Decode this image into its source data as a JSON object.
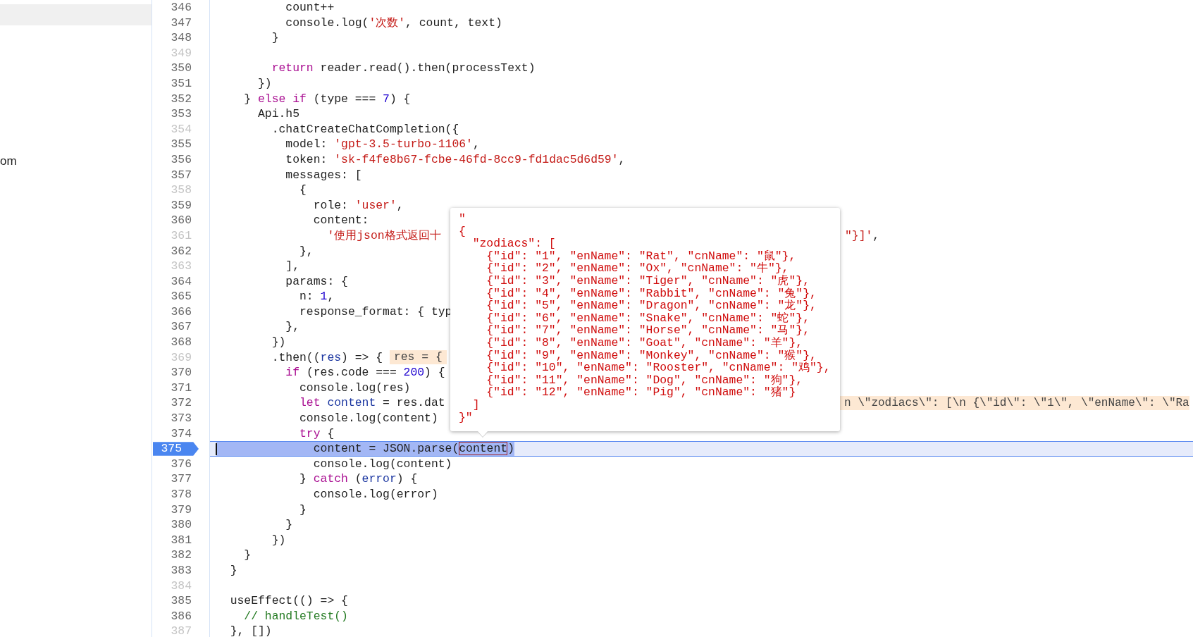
{
  "sidebar": {
    "items": [
      {
        "label": "om"
      }
    ]
  },
  "editor": {
    "lines": [
      {
        "number": "346",
        "breakable": true,
        "paused": false,
        "tokens": [
          {
            "kind": "plain",
            "text": "          count++"
          }
        ]
      },
      {
        "number": "347",
        "breakable": true,
        "paused": false,
        "tokens": [
          {
            "kind": "plain",
            "text": "          console.log("
          },
          {
            "kind": "string",
            "text": "'次数'"
          },
          {
            "kind": "plain",
            "text": ", count, text)"
          }
        ]
      },
      {
        "number": "348",
        "breakable": true,
        "paused": false,
        "tokens": [
          {
            "kind": "plain",
            "text": "        }"
          }
        ]
      },
      {
        "number": "349",
        "breakable": false,
        "paused": false
      },
      {
        "number": "350",
        "breakable": true,
        "paused": false,
        "tokens": [
          {
            "kind": "keyword",
            "text": "        return"
          },
          {
            "kind": "plain",
            "text": " reader.read().then(processText)"
          }
        ]
      },
      {
        "number": "351",
        "breakable": true,
        "paused": false,
        "tokens": [
          {
            "kind": "plain",
            "text": "      })"
          }
        ]
      },
      {
        "number": "352",
        "breakable": true,
        "paused": false,
        "tokens": [
          {
            "kind": "plain",
            "text": "    } "
          },
          {
            "kind": "keyword",
            "text": "else if"
          },
          {
            "kind": "plain",
            "text": " (type === "
          },
          {
            "kind": "number",
            "text": "7"
          },
          {
            "kind": "plain",
            "text": ") {"
          }
        ]
      },
      {
        "number": "353",
        "breakable": true,
        "paused": false,
        "tokens": [
          {
            "kind": "plain",
            "text": "      Api.h5"
          }
        ]
      },
      {
        "number": "354",
        "breakable": false,
        "paused": false,
        "tokens": [
          {
            "kind": "plain",
            "text": "        .chatCreateChatCompletion({"
          }
        ]
      },
      {
        "number": "355",
        "breakable": true,
        "paused": false,
        "tokens": [
          {
            "kind": "plain",
            "text": "          model: "
          },
          {
            "kind": "string",
            "text": "'gpt-3.5-turbo-1106'"
          },
          {
            "kind": "plain",
            "text": ","
          }
        ]
      },
      {
        "number": "356",
        "breakable": true,
        "paused": false,
        "tokens": [
          {
            "kind": "plain",
            "text": "          token: "
          },
          {
            "kind": "string",
            "text": "'sk-f4fe8b67-fcbe-46fd-8cc9-fd1dac5d6d59'"
          },
          {
            "kind": "plain",
            "text": ","
          }
        ]
      },
      {
        "number": "357",
        "breakable": true,
        "paused": false,
        "tokens": [
          {
            "kind": "plain",
            "text": "          messages: ["
          }
        ]
      },
      {
        "number": "358",
        "breakable": false,
        "paused": false,
        "tokens": [
          {
            "kind": "plain",
            "text": "            {"
          }
        ]
      },
      {
        "number": "359",
        "breakable": true,
        "paused": false,
        "tokens": [
          {
            "kind": "plain",
            "text": "              role: "
          },
          {
            "kind": "string",
            "text": "'user'"
          },
          {
            "kind": "plain",
            "text": ","
          }
        ]
      },
      {
        "number": "360",
        "breakable": true,
        "paused": false,
        "tokens": [
          {
            "kind": "plain",
            "text": "              content:"
          }
        ]
      },
      {
        "number": "361",
        "breakable": false,
        "paused": false,
        "tokens": [
          {
            "kind": "string",
            "text": "                '使用json格式返回十"
          }
        ],
        "right": [
          {
            "kind": "string",
            "text": "\"}]'"
          },
          {
            "kind": "plain",
            "text": ","
          }
        ]
      },
      {
        "number": "362",
        "breakable": true,
        "paused": false,
        "tokens": [
          {
            "kind": "plain",
            "text": "            },"
          }
        ]
      },
      {
        "number": "363",
        "breakable": false,
        "paused": false,
        "tokens": [
          {
            "kind": "plain",
            "text": "          ],"
          }
        ]
      },
      {
        "number": "364",
        "breakable": true,
        "paused": false,
        "tokens": [
          {
            "kind": "plain",
            "text": "          params: {"
          }
        ]
      },
      {
        "number": "365",
        "breakable": true,
        "paused": false,
        "tokens": [
          {
            "kind": "plain",
            "text": "            n: "
          },
          {
            "kind": "number",
            "text": "1"
          },
          {
            "kind": "plain",
            "text": ","
          }
        ]
      },
      {
        "number": "366",
        "breakable": true,
        "paused": false,
        "tokens": [
          {
            "kind": "plain",
            "text": "            response_format: { typ"
          }
        ]
      },
      {
        "number": "367",
        "breakable": true,
        "paused": false,
        "tokens": [
          {
            "kind": "plain",
            "text": "          },"
          }
        ]
      },
      {
        "number": "368",
        "breakable": true,
        "paused": false,
        "tokens": [
          {
            "kind": "plain",
            "text": "        })"
          }
        ]
      },
      {
        "number": "369",
        "breakable": false,
        "paused": false,
        "tokens": [
          {
            "kind": "plain",
            "text": "        .then(("
          },
          {
            "kind": "variable",
            "text": "res"
          },
          {
            "kind": "plain",
            "text": ") => {"
          },
          {
            "kind": "inline_value",
            "text": "res = {"
          }
        ]
      },
      {
        "number": "370",
        "breakable": true,
        "paused": false,
        "tokens": [
          {
            "kind": "keyword",
            "text": "          if"
          },
          {
            "kind": "plain",
            "text": " (res.code === "
          },
          {
            "kind": "number",
            "text": "200"
          },
          {
            "kind": "plain",
            "text": ") {"
          }
        ]
      },
      {
        "number": "371",
        "breakable": true,
        "paused": false,
        "tokens": [
          {
            "kind": "plain",
            "text": "            console.log(res)"
          }
        ]
      },
      {
        "number": "372",
        "breakable": true,
        "paused": false,
        "tokens": [
          {
            "kind": "keyword",
            "text": "            let"
          },
          {
            "kind": "variable",
            "text": " content"
          },
          {
            "kind": "plain",
            "text": " = res.dat"
          }
        ],
        "right": [
          {
            "kind": "inline_value",
            "text": "n \\\"zodiacs\\\": [\\n {\\\"id\\\": \\\"1\\\", \\\"enName\\\": \\\"Ra"
          }
        ]
      },
      {
        "number": "373",
        "breakable": true,
        "paused": false,
        "tokens": [
          {
            "kind": "plain",
            "text": "            console.log(content)"
          }
        ]
      },
      {
        "number": "374",
        "breakable": true,
        "paused": false,
        "tokens": [
          {
            "kind": "keyword",
            "text": "            try"
          },
          {
            "kind": "plain",
            "text": " {"
          }
        ]
      },
      {
        "number": "375",
        "breakable": true,
        "paused": true,
        "tokens": [
          {
            "kind": "plain",
            "text": "              content = JSON.parse("
          },
          {
            "kind": "hovered",
            "text": "content"
          },
          {
            "kind": "plain",
            "text": ")"
          }
        ]
      },
      {
        "number": "376",
        "breakable": true,
        "paused": false,
        "tokens": [
          {
            "kind": "plain",
            "text": "              console.log(content)"
          }
        ]
      },
      {
        "number": "377",
        "breakable": true,
        "paused": false,
        "tokens": [
          {
            "kind": "plain",
            "text": "            } "
          },
          {
            "kind": "keyword",
            "text": "catch"
          },
          {
            "kind": "plain",
            "text": " ("
          },
          {
            "kind": "variable",
            "text": "error"
          },
          {
            "kind": "plain",
            "text": ") {"
          }
        ]
      },
      {
        "number": "378",
        "breakable": true,
        "paused": false,
        "tokens": [
          {
            "kind": "plain",
            "text": "              console.log(error)"
          }
        ]
      },
      {
        "number": "379",
        "breakable": true,
        "paused": false,
        "tokens": [
          {
            "kind": "plain",
            "text": "            }"
          }
        ]
      },
      {
        "number": "380",
        "breakable": true,
        "paused": false,
        "tokens": [
          {
            "kind": "plain",
            "text": "          }"
          }
        ]
      },
      {
        "number": "381",
        "breakable": true,
        "paused": false,
        "tokens": [
          {
            "kind": "plain",
            "text": "        })"
          }
        ]
      },
      {
        "number": "382",
        "breakable": true,
        "paused": false,
        "tokens": [
          {
            "kind": "plain",
            "text": "    }"
          }
        ]
      },
      {
        "number": "383",
        "breakable": true,
        "paused": false,
        "tokens": [
          {
            "kind": "plain",
            "text": "  }"
          }
        ]
      },
      {
        "number": "384",
        "breakable": false,
        "paused": false
      },
      {
        "number": "385",
        "breakable": true,
        "paused": false,
        "tokens": [
          {
            "kind": "plain",
            "text": "  useEffect(() => {"
          }
        ]
      },
      {
        "number": "386",
        "breakable": true,
        "paused": false,
        "tokens": [
          {
            "kind": "comment",
            "text": "    // handleTest()"
          }
        ]
      },
      {
        "number": "387",
        "breakable": false,
        "paused": false,
        "tokens": [
          {
            "kind": "plain",
            "text": "  }, [])"
          }
        ]
      }
    ]
  },
  "tooltip": {
    "lines": [
      "\"",
      "{",
      "  \"zodiacs\": [",
      "    {\"id\": \"1\", \"enName\": \"Rat\", \"cnName\": \"鼠\"},",
      "    {\"id\": \"2\", \"enName\": \"Ox\", \"cnName\": \"牛\"},",
      "    {\"id\": \"3\", \"enName\": \"Tiger\", \"cnName\": \"虎\"},",
      "    {\"id\": \"4\", \"enName\": \"Rabbit\", \"cnName\": \"兔\"},",
      "    {\"id\": \"5\", \"enName\": \"Dragon\", \"cnName\": \"龙\"},",
      "    {\"id\": \"6\", \"enName\": \"Snake\", \"cnName\": \"蛇\"},",
      "    {\"id\": \"7\", \"enName\": \"Horse\", \"cnName\": \"马\"},",
      "    {\"id\": \"8\", \"enName\": \"Goat\", \"cnName\": \"羊\"},",
      "    {\"id\": \"9\", \"enName\": \"Monkey\", \"cnName\": \"猴\"},",
      "    {\"id\": \"10\", \"enName\": \"Rooster\", \"cnName\": \"鸡\"},",
      "    {\"id\": \"11\", \"enName\": \"Dog\", \"cnName\": \"狗\"},",
      "    {\"id\": \"12\", \"enName\": \"Pig\", \"cnName\": \"猪\"}",
      "  ]",
      "}\""
    ]
  }
}
